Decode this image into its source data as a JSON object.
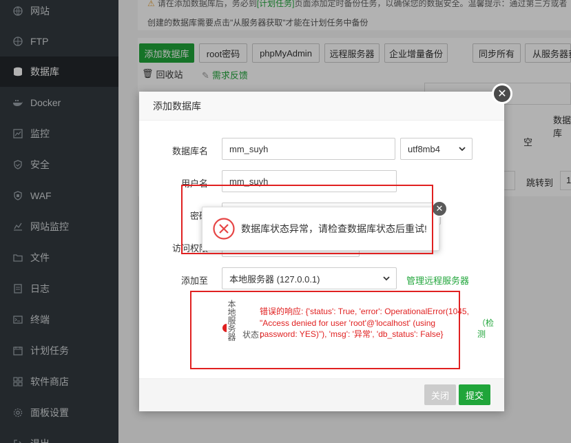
{
  "sidebar": {
    "items": [
      {
        "label": "网站",
        "icon": "globe-icon"
      },
      {
        "label": "FTP",
        "icon": "ftp-icon"
      },
      {
        "label": "数据库",
        "icon": "database-icon"
      },
      {
        "label": "Docker",
        "icon": "docker-icon"
      },
      {
        "label": "监控",
        "icon": "monitor-icon"
      },
      {
        "label": "安全",
        "icon": "shield-icon"
      },
      {
        "label": "WAF",
        "icon": "waf-icon"
      },
      {
        "label": "网站监控",
        "icon": "chart-icon"
      },
      {
        "label": "文件",
        "icon": "folder-icon"
      },
      {
        "label": "日志",
        "icon": "log-icon"
      },
      {
        "label": "终端",
        "icon": "terminal-icon"
      },
      {
        "label": "计划任务",
        "icon": "calendar-icon"
      },
      {
        "label": "软件商店",
        "icon": "apps-icon"
      },
      {
        "label": "面板设置",
        "icon": "gear-icon"
      },
      {
        "label": "退出",
        "icon": "logout-icon"
      }
    ]
  },
  "notice": {
    "line1_a": "请在添加数据库后，务必到",
    "line1_link": "[计划任务]",
    "line1_b": "页面添加定时备份任务，以确保您的数据安全。温馨提示：通过第三方或者",
    "line2": "创建的数据库需要点击\"从服务器获取\"才能在计划任务中备份"
  },
  "toolbar": {
    "add_db": "添加数据库",
    "root_pwd": "root密码",
    "phpmyadmin": "phpMyAdmin",
    "remote_server": "远程服务器",
    "enterprise_backup": "企业增量备份",
    "sync_all": "同步所有",
    "get_from_server": "从服务器获",
    "recycle_bin": "回收站",
    "feedback": "需求反馈"
  },
  "background": {
    "col_header": "数据库",
    "empty_cell": "空",
    "jump_to": "跳转到",
    "page_num": "1"
  },
  "modal": {
    "title": "添加数据库",
    "db_name_label": "数据库名",
    "db_name_value": "mm_suyh",
    "charset_value": "utf8mb4",
    "username_label": "用户名",
    "username_value": "mm_suyh",
    "password_label": "密码",
    "access_label": "访问权限",
    "add_to_label": "添加至",
    "add_to_value": "本地服务器 (127.0.0.1)",
    "manage_remote": "管理远程服务器",
    "local_server_label": "本地服务器",
    "status_label": "状态：",
    "status_error": "错误的响应: {'status': True, 'error': OperationalError(1045, \"Access denied for user 'root'@'localhost' (using password: YES)\"), 'msg': '异常', 'db_status': False}",
    "detect_link": "（检测",
    "close_btn": "关闭",
    "submit_btn": "提交"
  },
  "toast": {
    "message": "数据库状态异常，请检查数据库状态后重试!"
  },
  "colors": {
    "accent": "#20a53a",
    "error": "#e02020",
    "sidebar_bg": "#333a40"
  }
}
